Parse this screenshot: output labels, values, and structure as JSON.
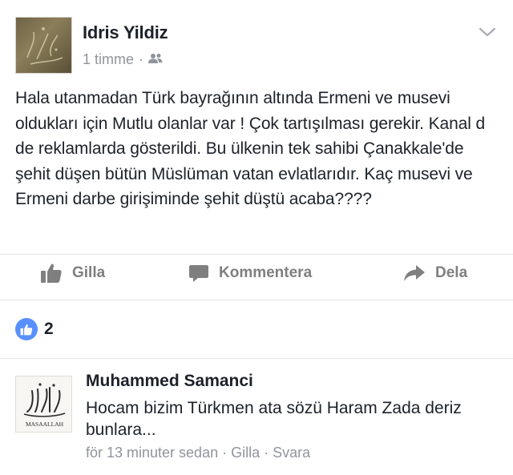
{
  "post": {
    "author": "Idris Yildiz",
    "time": "1 timme",
    "meta_separator": "·",
    "privacy_icon": "friends-icon",
    "menu_icon": "chevron-down-icon",
    "text": "Hala utanmadan Türk bayrağının altında Ermeni ve musevi oldukları için Mutlu olanlar var ! Çok tartışılması gerekir. Kanal d de reklamlarda gösterildi. Bu ülkenin tek sahibi Çanakkale'de şehit düşen bütün Müslüman vatan evlatlarıdır. Kaç musevi ve Ermeni darbe girişiminde şehit düştü acaba????"
  },
  "actions": {
    "like_label": "Gilla",
    "comment_label": "Kommentera",
    "share_label": "Dela"
  },
  "reactions": {
    "icon": "like-icon",
    "count": "2"
  },
  "comment": {
    "author": "Muhammed Samanci",
    "text": "Hocam bizim Türkmen ata sözü Haram Zada deriz bunlara...",
    "time": "för 13 minuter sedan",
    "separator": "·",
    "like_label": "Gilla",
    "reply_label": "Svara",
    "avatar_caption": "MASAALLAH"
  },
  "colors": {
    "meta_gray": "#90949c",
    "action_gray": "#7f7f7f",
    "like_blue": "#5890ff",
    "text": "#1d2129"
  }
}
